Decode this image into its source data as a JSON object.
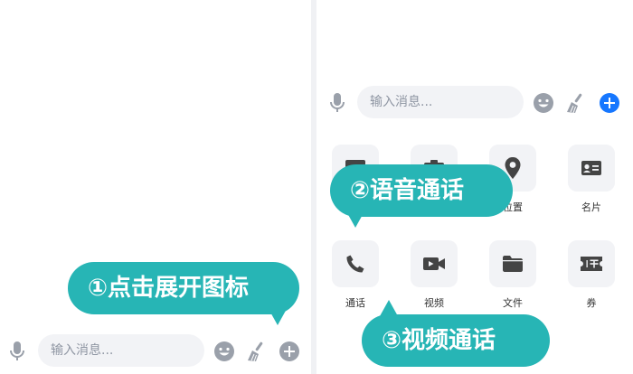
{
  "input_placeholder": "输入消息...",
  "callouts": {
    "step1": "①点击展开图标",
    "step2": "②语音通话",
    "step3": "③视频通话"
  },
  "panel_items": [
    {
      "label": "",
      "icon": "image-icon"
    },
    {
      "label": "",
      "icon": "camera-icon"
    },
    {
      "label": "位置",
      "icon": "location-pin-icon"
    },
    {
      "label": "名片",
      "icon": "contact-card-icon"
    },
    {
      "label": "通话",
      "icon": "phone-icon"
    },
    {
      "label": "视频",
      "icon": "video-camera-icon"
    },
    {
      "label": "文件",
      "icon": "folder-icon"
    },
    {
      "label": "券",
      "icon": "coupon-icon"
    }
  ],
  "colors": {
    "callout": "#27b5b5",
    "accent_blue": "#1677ff",
    "icon_gray": "#9aa0aa",
    "tile_bg": "#f2f3f6"
  }
}
